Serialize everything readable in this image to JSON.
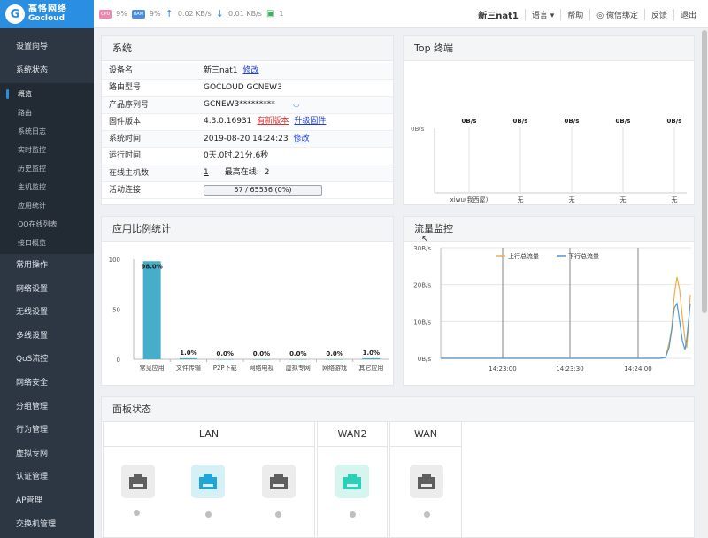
{
  "brand": {
    "cn": "高恪网络",
    "en": "Gocloud"
  },
  "topstats": {
    "cpu_chip": "CPU",
    "cpu": "9%",
    "ram_chip": "RAM",
    "ram": "9%",
    "up": "0.02 KB/s",
    "down": "0.01 KB/s",
    "monitor": "1"
  },
  "usernav": [
    "新三nat1",
    "语言 ▾",
    "帮助",
    "微信绑定",
    "反馈",
    "退出"
  ],
  "sidebar": {
    "top": [
      "设置向导",
      "系统状态"
    ],
    "sub": [
      "概览",
      "路由",
      "系统日志",
      "实时监控",
      "历史监控",
      "主机监控",
      "应用统计",
      "QQ在线列表",
      "接口概览"
    ],
    "items": [
      "常用操作",
      "网络设置",
      "无线设置",
      "多线设置",
      "QoS流控",
      "网络安全",
      "分组管理",
      "行为管理",
      "虚拟专网",
      "认证管理",
      "AP管理",
      "交换机管理"
    ]
  },
  "system": {
    "title": "系统",
    "rows": {
      "device_name": {
        "k": "设备名",
        "v": "新三nat1",
        "link": "修改"
      },
      "model": {
        "k": "路由型号",
        "v": "GOCLOUD GCNEW3"
      },
      "serial": {
        "k": "产品序列号",
        "v": "GCNEW3*********"
      },
      "firmware": {
        "k": "固件版本",
        "v": "4.3.0.16931",
        "new": "有新版本",
        "link": "升级固件"
      },
      "time": {
        "k": "系统时间",
        "v": "2019-08-20 14:24:23",
        "link": "修改"
      },
      "uptime": {
        "k": "运行时间",
        "v": "0天,0时,21分,6秒"
      },
      "hosts": {
        "k": "在线主机数",
        "v": "1",
        "max_label": "最高在线:",
        "max": "2"
      },
      "connections": {
        "k": "活动连接",
        "v": "57 / 65536 (0%)",
        "fraction": 0.0009
      }
    }
  },
  "top": {
    "title": "Top 终端",
    "ylabel": "0B/s",
    "values": [
      "0B/s",
      "0B/s",
      "0B/s",
      "0B/s",
      "0B/s"
    ],
    "names": [
      "xiwu(我西屋)",
      "无",
      "无",
      "无",
      "无"
    ]
  },
  "chart_data": [
    {
      "type": "bar",
      "title": "应用比例统计",
      "categories": [
        "常见应用",
        "文件传输",
        "P2P下载",
        "网络电视",
        "虚拟专网",
        "网络游戏",
        "其它应用"
      ],
      "values": [
        98.0,
        1.0,
        0.0,
        0.0,
        0.0,
        0.0,
        1.0
      ],
      "labels": [
        "98.0%",
        "1.0%",
        "0.0%",
        "0.0%",
        "0.0%",
        "0.0%",
        "1.0%"
      ],
      "yticks": [
        "0",
        "50",
        "100"
      ],
      "ylim": [
        0,
        100
      ],
      "color": "#45aecb"
    },
    {
      "type": "line",
      "title": "流量监控",
      "yticks": [
        "0B/s",
        "10B/s",
        "20B/s",
        "30B/s"
      ],
      "ylim": [
        0,
        30
      ],
      "xticks": [
        "14:23:00",
        "14:23:30",
        "14:24:00"
      ],
      "series": [
        {
          "name": "上行总流量",
          "color": "#f2ac46"
        },
        {
          "name": "下行总流量",
          "color": "#4c98d6"
        }
      ]
    }
  ],
  "ports": {
    "title": "面板状态",
    "lan_label": "LAN",
    "wan2_label": "WAN2",
    "wan_label": "WAN"
  }
}
